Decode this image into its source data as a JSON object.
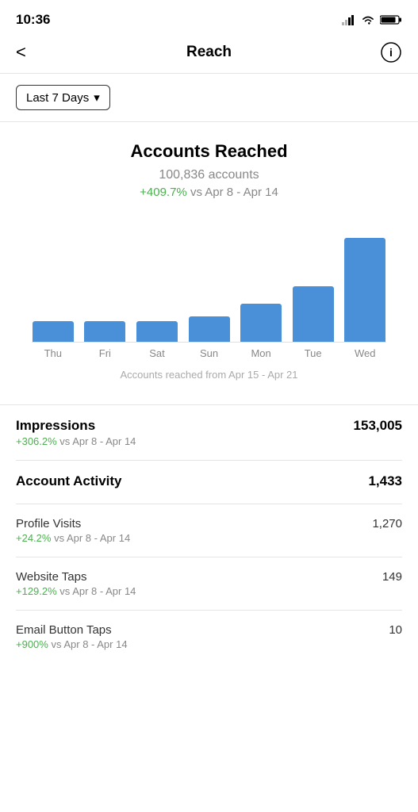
{
  "statusBar": {
    "time": "10:36"
  },
  "nav": {
    "backLabel": "<",
    "title": "Reach",
    "infoLabel": "ⓘ"
  },
  "filter": {
    "label": "Last 7 Days",
    "chevron": "▾"
  },
  "accountsReached": {
    "title": "Accounts Reached",
    "count": "100,836 accounts",
    "change": "+409.7%",
    "changeSuffix": " vs Apr 8 - Apr 14",
    "chartCaption": "Accounts reached from Apr 15 - Apr 21"
  },
  "chart": {
    "bars": [
      {
        "label": "Thu",
        "heightPct": 16
      },
      {
        "label": "Fri",
        "heightPct": 16
      },
      {
        "label": "Sat",
        "heightPct": 16
      },
      {
        "label": "Sun",
        "heightPct": 20
      },
      {
        "label": "Mon",
        "heightPct": 30
      },
      {
        "label": "Tue",
        "heightPct": 44
      },
      {
        "label": "Wed",
        "heightPct": 82
      }
    ]
  },
  "stats": [
    {
      "id": "impressions",
      "label": "Impressions",
      "value": "153,005",
      "bold": true,
      "change": "+306.2%",
      "changeSuffix": " vs Apr 8 - Apr 14"
    },
    {
      "id": "account-activity",
      "label": "Account Activity",
      "value": "1,433",
      "bold": true,
      "change": "",
      "changeSuffix": ""
    },
    {
      "id": "profile-visits",
      "label": "Profile Visits",
      "value": "1,270",
      "bold": false,
      "change": "+24.2%",
      "changeSuffix": " vs Apr 8 - Apr 14"
    },
    {
      "id": "website-taps",
      "label": "Website Taps",
      "value": "149",
      "bold": false,
      "change": "+129.2%",
      "changeSuffix": " vs Apr 8 - Apr 14"
    },
    {
      "id": "email-button-taps",
      "label": "Email Button Taps",
      "value": "10",
      "bold": false,
      "change": "+900%",
      "changeSuffix": " vs Apr 8 - Apr 14"
    }
  ]
}
